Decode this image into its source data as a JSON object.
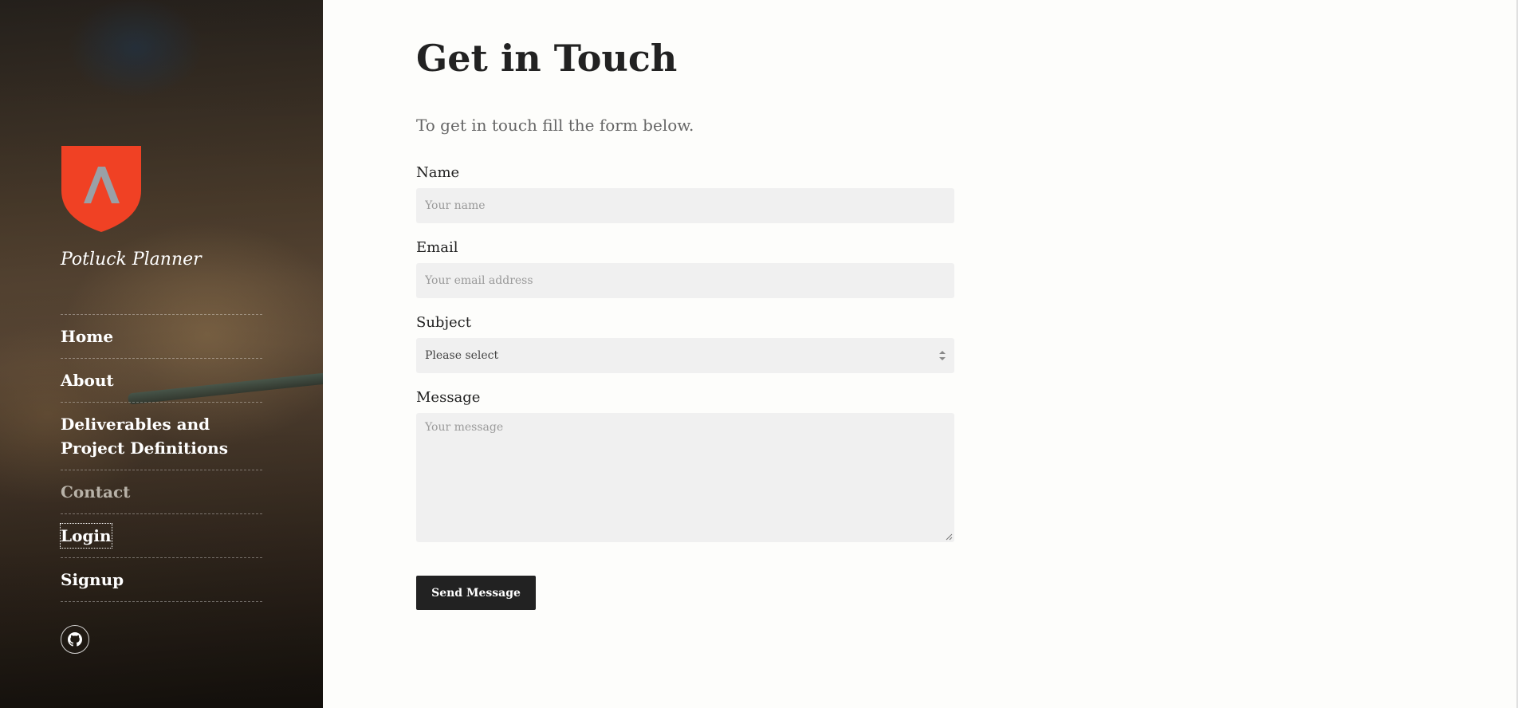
{
  "site": {
    "title": "Potluck Planner"
  },
  "nav": {
    "items": [
      {
        "label": "Home"
      },
      {
        "label": "About"
      },
      {
        "label": "Deliverables and Project Definitions"
      },
      {
        "label": "Contact"
      },
      {
        "label": "Login"
      },
      {
        "label": "Signup"
      }
    ],
    "active": "Contact"
  },
  "social": {
    "icon": "github-icon"
  },
  "colors": {
    "logo_shield": "#f04124",
    "button_bg": "#222222",
    "input_bg": "#f0f0f0"
  },
  "page": {
    "heading": "Get in Touch",
    "intro": "To get in touch fill the form below."
  },
  "form": {
    "name_label": "Name",
    "name_placeholder": "Your name",
    "email_label": "Email",
    "email_placeholder": "Your email address",
    "subject_label": "Subject",
    "subject_value": "Please select",
    "message_label": "Message",
    "message_placeholder": "Your message",
    "submit_label": "Send Message"
  }
}
